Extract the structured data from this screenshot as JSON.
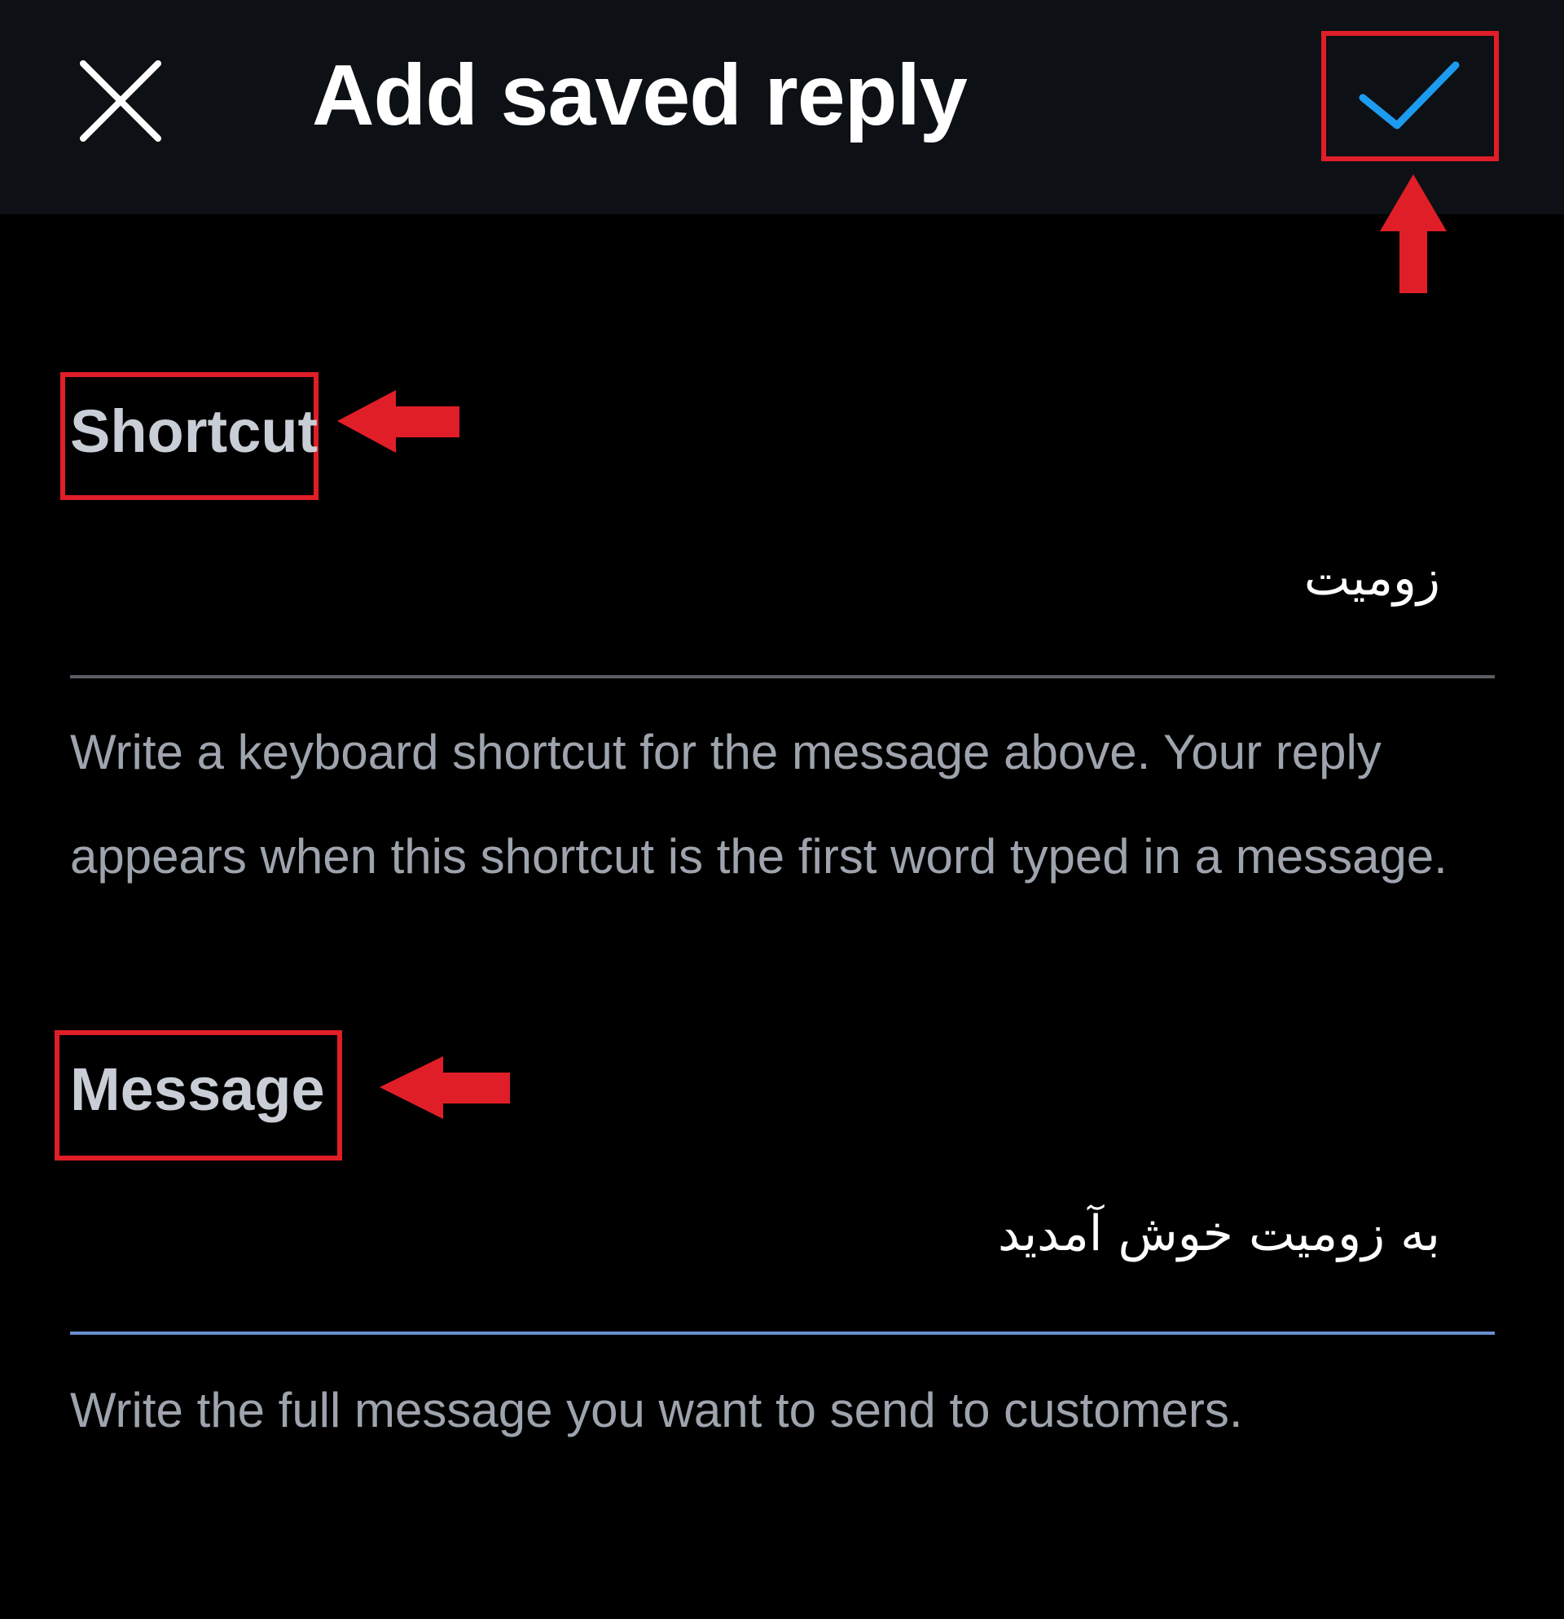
{
  "app_bar": {
    "title": "Add saved reply",
    "close_icon": "close-icon",
    "save_icon": "check-icon"
  },
  "shortcut": {
    "label": "Shortcut",
    "value": "زومیت",
    "helper": "Write a keyboard shortcut for the message above. Your reply appears when this shortcut is the first word typed in a message."
  },
  "message": {
    "label": "Message",
    "value": "به زومیت خوش آمدید",
    "helper": "Write the full message you want to send to customers."
  },
  "colors": {
    "app_bar_bg": "#0d1014",
    "background": "#000000",
    "accent_blue": "#1d9bf0",
    "annotation_red": "#e01e28",
    "inactive_line": "#5a5e63",
    "active_line": "#6b8fcf"
  }
}
